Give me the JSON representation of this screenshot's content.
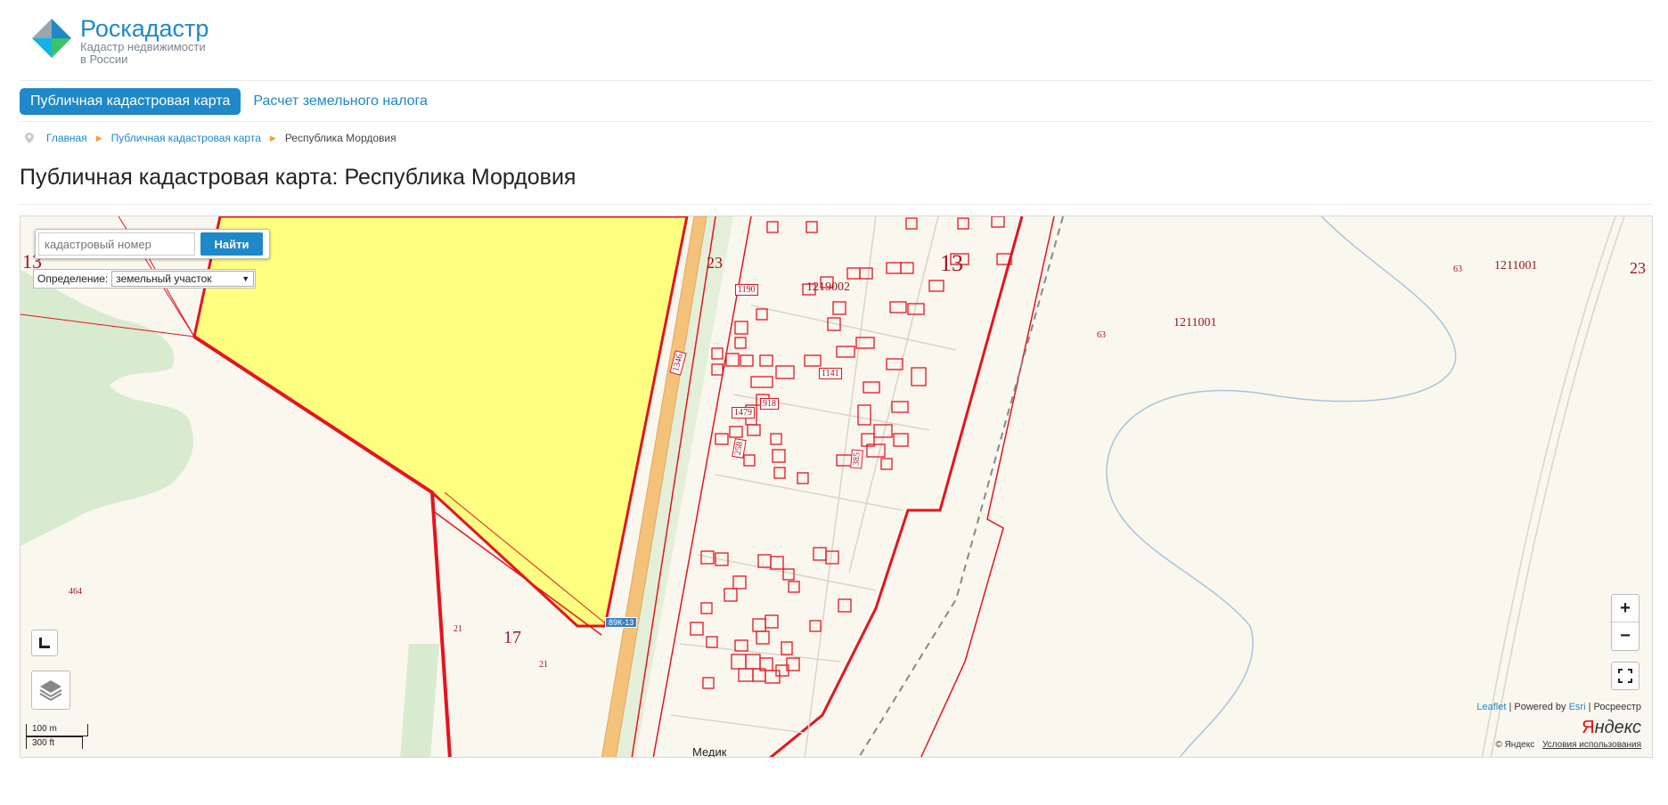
{
  "header": {
    "logo_title": "Роскадастр",
    "logo_sub1": "Кадастр недвижимости",
    "logo_sub2": "в России"
  },
  "nav": {
    "active": "Публичная кадастровая карта",
    "link": "Расчет земельного налога"
  },
  "breadcrumb": {
    "home": "Главная",
    "map": "Публичная кадастровая карта",
    "current": "Республика Мордовия"
  },
  "page_title": "Публичная кадастровая карта: Республика Мордовия",
  "search": {
    "placeholder": "кадастровый номер",
    "button": "Найти",
    "define_label": "Определение:",
    "define_value": "земельный участок"
  },
  "zoom": {
    "plus": "+",
    "minus": "−"
  },
  "scale": {
    "metric": "100 m",
    "imperial": "300 ft"
  },
  "attribution": {
    "leaflet": "Leaflet",
    "powered": "| Powered by",
    "esri": "Esri",
    "rosreestr": "| Росреестр",
    "yandex_y": "Я",
    "yandex_rest": "ндекс",
    "copyright": "© Яндекс",
    "terms": "Условия использования"
  },
  "map_labels": {
    "q13_left": "13",
    "q23_a": "23",
    "q13_center": "13",
    "q1219002": "1219002",
    "q1211001_a": "1211001",
    "q1211001_b": "1211001",
    "q63_a": "63",
    "q63_b": "63",
    "q23_right": "23",
    "q464": "464",
    "q21_a": "21",
    "q21_b": "21",
    "q17": "17",
    "road": "89К-13",
    "medik": "Медик",
    "n1190": "1190",
    "n1346": "1346",
    "n1141": "1141",
    "n918": "918",
    "n1479": "1479",
    "n258": "258",
    "n385": "385"
  },
  "colors": {
    "accent": "#1e88c9",
    "parcel_border": "#e5141e",
    "selected_fill": "#ffff80",
    "forest": "#d9ebcf",
    "road": "#f5c27a"
  }
}
